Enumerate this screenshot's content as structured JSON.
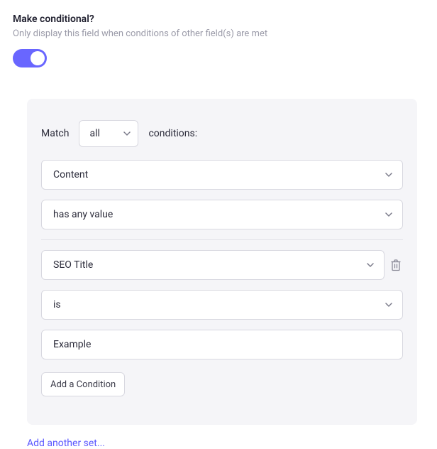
{
  "header": {
    "title": "Make conditional?",
    "subtitle": "Only display this field when conditions of other field(s) are met"
  },
  "toggle": {
    "on": true
  },
  "panel": {
    "match_prefix": "Match",
    "match_mode": "all",
    "match_suffix": "conditions:",
    "conditions": [
      {
        "field": "Content",
        "operator": "has any value",
        "value": "",
        "deletable": false
      },
      {
        "field": "SEO Title",
        "operator": "is",
        "value": "Example",
        "deletable": true
      }
    ],
    "add_condition_label": "Add a Condition"
  },
  "add_set_label": "Add another set..."
}
